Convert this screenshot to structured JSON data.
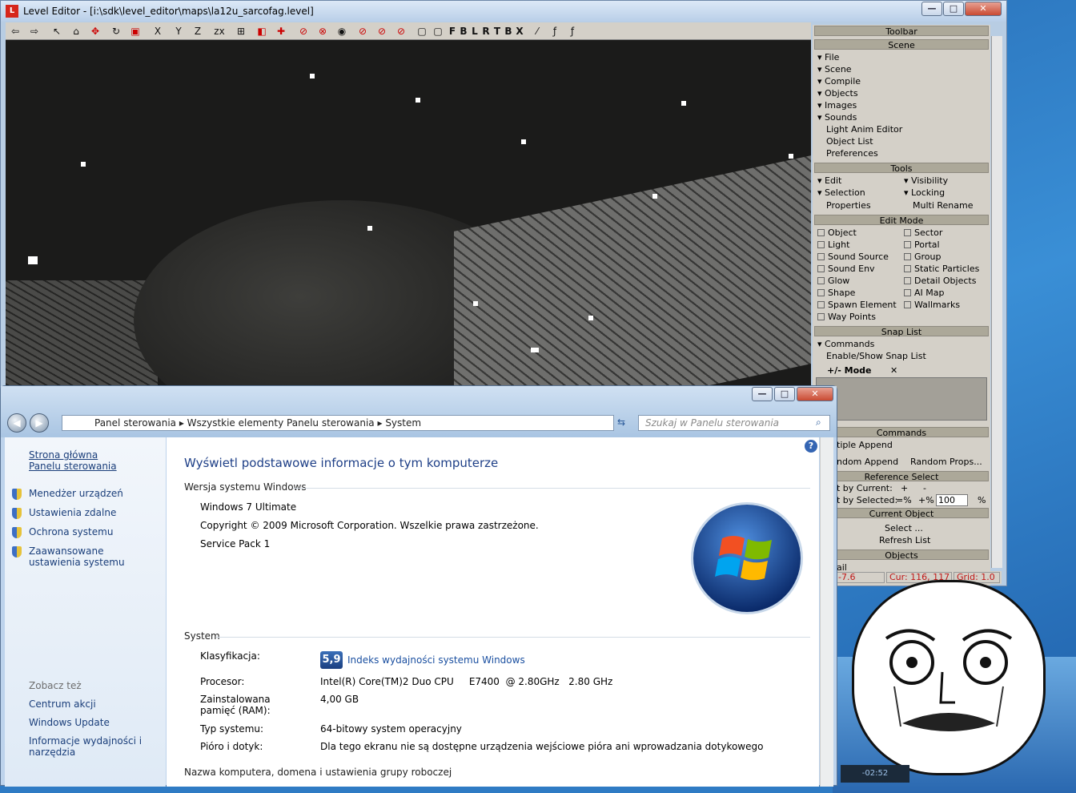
{
  "level_editor": {
    "title": "Level Editor - [i:\\sdk\\level_editor\\maps\\la12u_sarcofag.level]",
    "app_icon": "L",
    "win_min": "—",
    "win_max": "□",
    "win_close": "✕",
    "toolbar_letters": [
      "X",
      "Y",
      "Z",
      "zx",
      "F",
      "B",
      "L",
      "R",
      "T",
      "B",
      "X"
    ],
    "panel": {
      "toolbar_header": "Toolbar",
      "scene_header": "Scene",
      "scene_items": [
        "File",
        "Scene",
        "Compile",
        "Objects",
        "Images",
        "Sounds",
        "Light Anim Editor",
        "Object List",
        "Preferences"
      ],
      "tools_header": "Tools",
      "tools_left": [
        "Edit",
        "Selection",
        "Properties"
      ],
      "tools_right": [
        "Visibility",
        "Locking",
        "Multi Rename"
      ],
      "editmode_header": "Edit Mode",
      "editmode_left": [
        "Object",
        "Light",
        "Sound Source",
        "Sound Env",
        "Glow",
        "Shape",
        "Spawn Element",
        "Way Points"
      ],
      "editmode_right": [
        "Sector",
        "Portal",
        "Group",
        "Static Particles",
        "Detail Objects",
        "AI Map",
        "Wallmarks"
      ],
      "snap_header": "Snap List",
      "snap_items": [
        "Commands",
        "Enable/Show Snap List"
      ],
      "mode_label": "+/- Mode",
      "mode_close": "✕",
      "commands_header": "Commands",
      "multiple_append": "tiple Append",
      "random_append": "ndom Append",
      "random_props": "Random Props...",
      "refselect_header": "Reference Select",
      "by_current": "t by Current:",
      "by_selected": "t by Selected:",
      "plus": "+",
      "minus": "-",
      "eqpct": "=%",
      "pluspct": "+%",
      "pct_value": "100",
      "pct": "%",
      "current_object_header": "Current Object",
      "select_btn": "Select ...",
      "refresh_btn": "Refresh List",
      "objects_header": "Objects",
      "mail_fragment": "ail"
    },
    "status": {
      "coord": "-7.6",
      "cur": "Cur: 116, 117",
      "grid": "Grid: 1.0"
    }
  },
  "system_window": {
    "breadcrumb": [
      "Panel sterowania",
      "Wszystkie elementy Panelu sterowania",
      "System"
    ],
    "search_placeholder": "Szukaj w Panelu sterowania",
    "left_home": "Strona główna Panelu sterowania",
    "left_links": [
      "Menedżer urządzeń",
      "Ustawienia zdalne",
      "Ochrona systemu",
      "Zaawansowane ustawienia systemu"
    ],
    "see_also": "Zobacz też",
    "see_also_links": [
      "Centrum akcji",
      "Windows Update",
      "Informacje wydajności i narzędzia"
    ],
    "heading": "Wyświetl podstawowe informacje o tym komputerze",
    "edition_section": "Wersja systemu Windows",
    "edition": "Windows 7 Ultimate",
    "copyright": "Copyright © 2009 Microsoft Corporation. Wszelkie prawa zastrzeżone.",
    "service_pack": "Service Pack 1",
    "system_section": "System",
    "rating_label": "Klasyfikacja:",
    "rating_value": "5,9",
    "rating_link": "Indeks wydajności systemu Windows",
    "cpu_label": "Procesor:",
    "cpu_value": "Intel(R) Core(TM)2 Duo CPU     E7400  @ 2.80GHz   2.80 GHz",
    "ram_label": "Zainstalowana pamięć (RAM):",
    "ram_value": "4,00 GB",
    "type_label": "Typ systemu:",
    "type_value": "64-bitowy system operacyjny",
    "pen_label": "Pióro i dotyk:",
    "pen_value": "Dla tego ekranu nie są dostępne urządzenia wejściowe pióra ani wprowadzania dotykowego",
    "computer_section": "Nazwa komputera, domena i ustawienia grupy roboczej",
    "help": "?"
  },
  "tray_clock": "-02:52"
}
